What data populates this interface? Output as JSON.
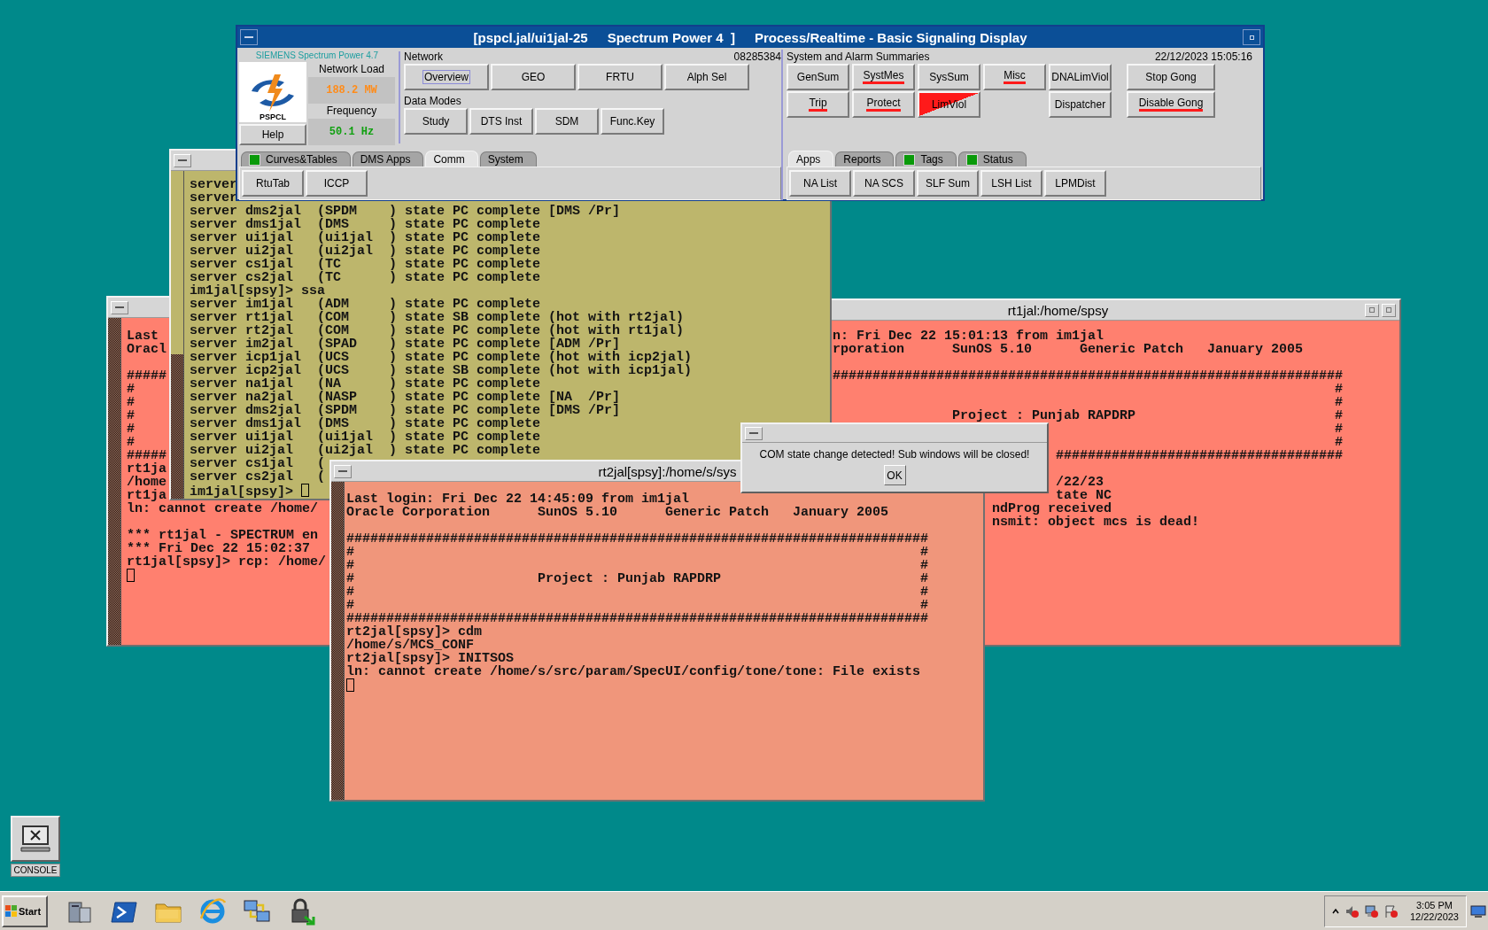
{
  "control_panel": {
    "title_parts": [
      "[pspcl.jal/ui1jal-25",
      "Spectrum Power 4  ]",
      "Process/Realtime - Basic Signaling Display"
    ],
    "vendor": "SIEMENS Spectrum Power 4.7",
    "logo_text": "PSPCL",
    "readings": [
      {
        "label": "Network Load",
        "value": "188.2 MW",
        "color": "#ff8c1a"
      },
      {
        "label": "Frequency",
        "value": "50.1 Hz",
        "color": "#10a010"
      }
    ],
    "help": "Help",
    "network": {
      "label": "Network",
      "code": "08285384",
      "buttons": [
        {
          "label": "Overview",
          "focused": true
        },
        {
          "label": "GEO",
          "focused": false
        },
        {
          "label": "FRTU",
          "focused": false
        },
        {
          "label": "Alph Sel",
          "focused": false
        }
      ]
    },
    "data_modes": {
      "label": "Data Modes",
      "buttons": [
        "Study",
        "DTS Inst",
        "SDM",
        "Func.Key"
      ]
    },
    "left_tabs": [
      {
        "label": "Curves&Tables",
        "selected": false,
        "indicator": true
      },
      {
        "label": "DMS Apps",
        "selected": false,
        "indicator": false
      },
      {
        "label": "Comm",
        "selected": true,
        "indicator": false
      },
      {
        "label": "System",
        "selected": false,
        "indicator": false
      }
    ],
    "left_buttons": [
      "RtuTab",
      "ICCP"
    ],
    "alarms": {
      "label": "System and Alarm Summaries",
      "timestamp": "22/12/2023 15:05:16",
      "grid": [
        {
          "kind": "button",
          "label": "GenSum",
          "alarm": false,
          "limit_flag": false
        },
        {
          "kind": "button",
          "label": "SystMes",
          "alarm": true,
          "limit_flag": false
        },
        {
          "kind": "button",
          "label": "SysSum",
          "alarm": false,
          "limit_flag": false
        },
        {
          "kind": "button",
          "label": "Misc",
          "alarm": true,
          "limit_flag": false
        },
        {
          "kind": "button",
          "label": "DNALimViol",
          "alarm": false,
          "limit_flag": false
        },
        {
          "kind": "button",
          "label": "Trip",
          "alarm": true,
          "limit_flag": false
        },
        {
          "kind": "button",
          "label": "Protect",
          "alarm": true,
          "limit_flag": false
        },
        {
          "kind": "button",
          "label": "LimViol",
          "alarm": false,
          "limit_flag": true
        },
        {
          "kind": "gap"
        },
        {
          "kind": "button",
          "label": "Dispatcher",
          "alarm": false,
          "limit_flag": false
        }
      ],
      "gong": [
        {
          "label": "Stop Gong",
          "alarm": false
        },
        {
          "label": "Disable Gong",
          "alarm": true
        }
      ]
    },
    "right_tabs": [
      {
        "label": "Apps",
        "selected": true,
        "indicator": false
      },
      {
        "label": "Reports",
        "selected": false,
        "indicator": false
      },
      {
        "label": "Tags",
        "selected": false,
        "indicator": true
      },
      {
        "label": "Status",
        "selected": false,
        "indicator": true
      }
    ],
    "right_buttons": [
      "NA List",
      "NA SCS",
      "SLF Sum",
      "LSH List",
      "LPMDist"
    ]
  },
  "console_terminal": {
    "menu_button": true,
    "scrollbar": true,
    "lines": [
      {
        "kind": "text",
        "text": "server"
      },
      {
        "kind": "text",
        "text": "server"
      },
      {
        "kind": "text",
        "text": "server dms2jal  (SPDM    ) state PC complete [DMS /Pr]"
      },
      {
        "kind": "text",
        "text": "server dms1jal  (DMS     ) state PC complete"
      },
      {
        "kind": "text",
        "text": "server ui1jal   (ui1jal  ) state PC complete"
      },
      {
        "kind": "text",
        "text": "server ui2jal   (ui2jal  ) state PC complete"
      },
      {
        "kind": "text",
        "text": "server cs1jal   (TC      ) state PC complete"
      },
      {
        "kind": "text",
        "text": "server cs2jal   (TC      ) state PC complete"
      },
      {
        "kind": "text",
        "text": "im1jal[spsy]> ssa"
      },
      {
        "kind": "text",
        "text": "server im1jal   (ADM     ) state PC complete"
      },
      {
        "kind": "text",
        "text": "server rt1jal   (COM     ) state SB complete (hot with rt2jal)"
      },
      {
        "kind": "text",
        "text": "server rt2jal   (COM     ) state PC complete (hot with rt1jal)"
      },
      {
        "kind": "text",
        "text": "server im2jal   (SPAD    ) state PC complete [ADM /Pr]"
      },
      {
        "kind": "text",
        "text": "server icp1jal  (UCS     ) state PC complete (hot with icp2jal)"
      },
      {
        "kind": "text",
        "text": "server icp2jal  (UCS     ) state SB complete (hot with icp1jal)"
      },
      {
        "kind": "text",
        "text": "server na1jal   (NA      ) state PC complete"
      },
      {
        "kind": "text",
        "text": "server na2jal   (NASP    ) state PC complete [NA  /Pr]"
      },
      {
        "kind": "text",
        "text": "server dms2jal  (SPDM    ) state PC complete [DMS /Pr]"
      },
      {
        "kind": "text",
        "text": "server dms1jal  (DMS     ) state PC complete"
      },
      {
        "kind": "text",
        "text": "server ui1jal   (ui1jal  ) state PC complete"
      },
      {
        "kind": "text",
        "text": "server ui2jal   (ui2jal  ) state PC complete"
      },
      {
        "kind": "text",
        "text": "server cs1jal   ("
      },
      {
        "kind": "text",
        "text": "server cs2jal   ("
      },
      {
        "kind": "prompt_cursor",
        "text": "im1jal[spsy]>"
      }
    ]
  },
  "left_terminal": {
    "menu_button": true,
    "scrollbar": true,
    "lines": [
      {
        "kind": "text",
        "text": "Last"
      },
      {
        "kind": "text",
        "text": "Oracl"
      },
      {
        "kind": "blank"
      },
      {
        "kind": "text",
        "text": "#####"
      },
      {
        "kind": "text",
        "text": "#"
      },
      {
        "kind": "text",
        "text": "#"
      },
      {
        "kind": "text",
        "text": "#"
      },
      {
        "kind": "text",
        "text": "#"
      },
      {
        "kind": "text",
        "text": "#"
      },
      {
        "kind": "text",
        "text": "#####"
      },
      {
        "kind": "text",
        "text": "rt1ja"
      },
      {
        "kind": "text",
        "text": "/home"
      },
      {
        "kind": "text",
        "text": "rt1ja"
      },
      {
        "kind": "text",
        "text": "ln: cannot create /home/"
      },
      {
        "kind": "blank"
      },
      {
        "kind": "text",
        "text": "*** rt1jal - SPECTRUM en"
      },
      {
        "kind": "text",
        "text": "*** Fri Dec 22 15:02:37"
      },
      {
        "kind": "text",
        "text": "rt1jal[spsy]> rcp: /home/"
      },
      {
        "kind": "cursor"
      }
    ]
  },
  "right_terminal": {
    "title": "rt1jal:/home/spsy",
    "window_controls": true,
    "lines": [
      {
        "kind": "text",
        "text": "n: Fri Dec 22 15:01:13 from im1jal"
      },
      {
        "kind": "text",
        "text": "rporation      SunOS 5.10      Generic Patch   January 2005"
      },
      {
        "kind": "blank"
      },
      {
        "kind": "text",
        "text": "################################################################"
      },
      {
        "kind": "text",
        "text": "                                                               #"
      },
      {
        "kind": "text",
        "text": "                                                               #"
      },
      {
        "kind": "text",
        "text": "               Project : Punjab RAPDRP                         #"
      },
      {
        "kind": "beside_dialog",
        "text": "                                   #"
      },
      {
        "kind": "beside_dialog",
        "text": "                                   #"
      },
      {
        "kind": "beside_dialog",
        "text": "####################################"
      },
      {
        "kind": "blank"
      },
      {
        "kind": "beside_dialog",
        "text": "/22/23"
      },
      {
        "kind": "beside_dialog",
        "text": "tate NC"
      },
      {
        "kind": "beside_window",
        "text": "ndProg received"
      },
      {
        "kind": "beside_window",
        "text": "nsmit: object mcs is dead!"
      }
    ]
  },
  "front_terminal": {
    "title": "rt2jal[spsy]:/home/s/sys",
    "menu_button": true,
    "scrollbar": true,
    "lines": [
      {
        "kind": "text",
        "text": "Last login: Fri Dec 22 14:45:09 from im1jal"
      },
      {
        "kind": "text",
        "text": "Oracle Corporation      SunOS 5.10      Generic Patch   January 2005"
      },
      {
        "kind": "blank"
      },
      {
        "kind": "text",
        "text": "#########################################################################"
      },
      {
        "kind": "text",
        "text": "#                                                                       #"
      },
      {
        "kind": "text",
        "text": "#                                                                       #"
      },
      {
        "kind": "text",
        "text": "#                       Project : Punjab RAPDRP                         #"
      },
      {
        "kind": "text",
        "text": "#                                                                       #"
      },
      {
        "kind": "text",
        "text": "#                                                                       #"
      },
      {
        "kind": "text",
        "text": "#########################################################################"
      },
      {
        "kind": "text",
        "text": "rt2jal[spsy]> cdm"
      },
      {
        "kind": "text",
        "text": "/home/s/MCS_CONF"
      },
      {
        "kind": "text",
        "text": "rt2jal[spsy]> INITSOS"
      },
      {
        "kind": "text",
        "text": "ln: cannot create /home/s/src/param/SpecUI/config/tone/tone: File exists"
      },
      {
        "kind": "cursor"
      }
    ]
  },
  "alert_dialog": {
    "message": "COM state change detected! Sub windows will be closed!",
    "button": "OK"
  },
  "desktop_icon": {
    "label": "CONSOLE"
  },
  "taskbar": {
    "start": "Start",
    "time": "3:05 PM",
    "date": "12/22/2023"
  }
}
